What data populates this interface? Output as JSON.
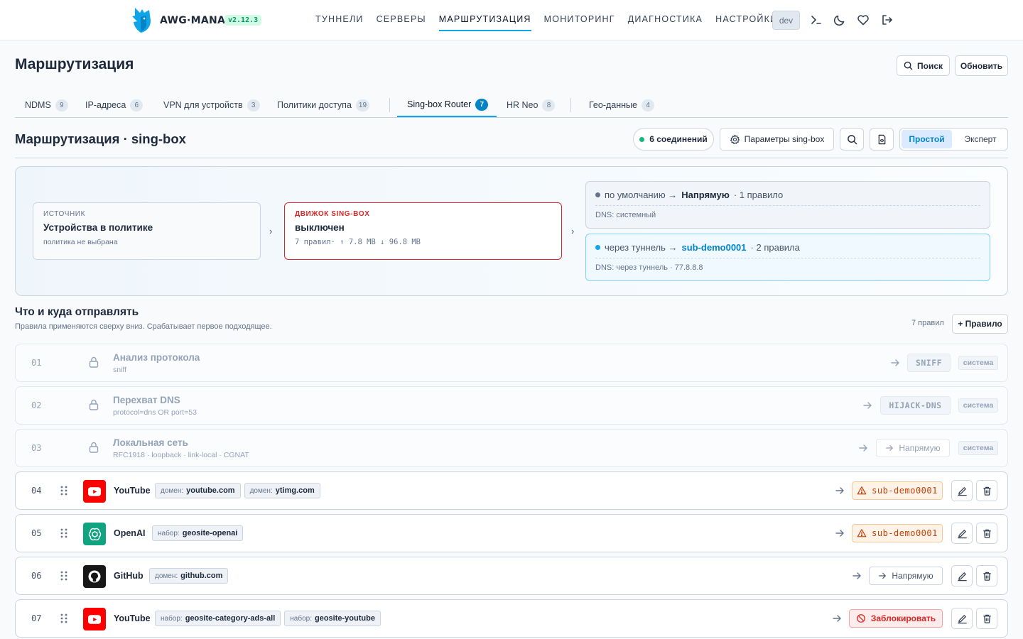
{
  "app": {
    "brand": "AWG·MANAGER",
    "version": "v2.12.3",
    "env": "dev"
  },
  "nav": [
    "ТУННЕЛИ",
    "СЕРВЕРЫ",
    "МАРШРУТИЗАЦИЯ",
    "МОНИТОРИНГ",
    "ДИАГНОСТИКА",
    "НАСТРОЙКИ"
  ],
  "page": {
    "title": "Маршрутизация",
    "search_label": "Поиск",
    "refresh_label": "Обновить"
  },
  "tabs": [
    {
      "label": "NDMS",
      "count": "9"
    },
    {
      "label": "IP-адреса",
      "count": "6"
    },
    {
      "label": "VPN для устройств",
      "count": "3"
    },
    {
      "label": "Политики доступа",
      "count": "19"
    },
    {
      "label": "Sing-box Router",
      "count": "7"
    },
    {
      "label": "HR Neo",
      "count": "8"
    },
    {
      "label": "Гео-данные",
      "count": "4"
    }
  ],
  "section": {
    "title": "Маршрутизация · sing-box",
    "connections": "6 соединений",
    "params_label": "Параметры sing-box",
    "mode_simple": "Простой",
    "mode_expert": "Эксперт"
  },
  "flow": {
    "source": {
      "caption": "ИСТОЧНИК",
      "title": "Устройства в политике",
      "sub": "политика не выбрана"
    },
    "engine": {
      "caption": "ДВИЖОК SING-BOX",
      "title": "выключен",
      "stats": "7 правил· ↑ 7.8 MB ↓ 96.8 MB"
    },
    "routes": [
      {
        "prefix": "по умолчанию →",
        "target": "Напрямую",
        "suffix": "· 1 правило",
        "dns": "DNS: системный"
      },
      {
        "prefix": "через туннель →",
        "target": "sub-demo0001",
        "suffix": "· 2 правила",
        "dns": "DNS: через туннель · 77.8.8.8"
      }
    ]
  },
  "rules_header": {
    "title": "Что и куда отправлять",
    "subtitle": "Правила применяются сверху вниз. Срабатывает первое подходящее.",
    "count": "7 правил",
    "add_label": "+ Правило"
  },
  "system_rules": [
    {
      "num": "01",
      "name": "Анализ протокола",
      "desc": "sniff",
      "target": "SNIFF",
      "badge": "система"
    },
    {
      "num": "02",
      "name": "Перехват DNS",
      "desc": "protocol=dns OR port=53",
      "target": "HIJACK-DNS",
      "badge": "система"
    },
    {
      "num": "03",
      "name": "Локальная сеть",
      "desc": "RFC1918 · loopback · link-local · CGNAT",
      "target": "Напрямую",
      "badge": "система"
    }
  ],
  "rules": [
    {
      "num": "04",
      "name": "YouTube",
      "icon": "youtube-icon",
      "tags": [
        {
          "k": "домен:",
          "v": "youtube.com"
        },
        {
          "k": "домен:",
          "v": "ytimg.com"
        }
      ],
      "target": "sub-demo0001"
    },
    {
      "num": "05",
      "name": "OpenAI",
      "icon": "openai-icon",
      "tags": [
        {
          "k": "набор:",
          "v": "geosite-openai"
        }
      ],
      "target": "sub-demo0001"
    },
    {
      "num": "06",
      "name": "GitHub",
      "icon": "github-icon",
      "tags": [
        {
          "k": "домен:",
          "v": "github.com"
        }
      ],
      "target": "Напрямую"
    },
    {
      "num": "07",
      "name": "YouTube",
      "icon": "youtube-icon",
      "tags": [
        {
          "k": "набор:",
          "v": "geosite-category-ads-all"
        },
        {
          "k": "набор:",
          "v": "geosite-youtube"
        }
      ],
      "target": "Заблокировать"
    }
  ],
  "colors": {
    "accent": "#0ea5e9",
    "success": "#10b981",
    "warn": "#c2410c",
    "danger": "#dc2626",
    "youtube": "#ff0000",
    "openai": "#10a37f",
    "github": "#171717"
  }
}
